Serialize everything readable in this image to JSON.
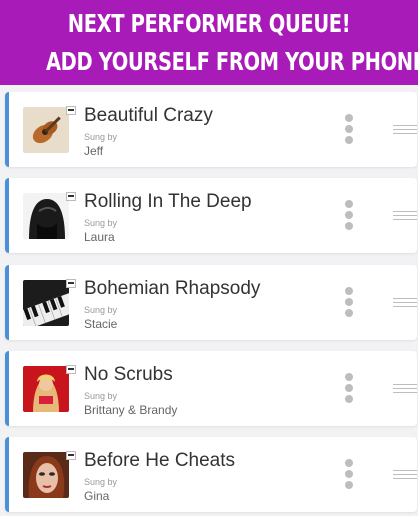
{
  "banner": {
    "line1": "NEXT PERFORMER QUEUE!",
    "line2": "ADD YOURSELF FROM YOUR PHONE"
  },
  "colors": {
    "banner_bg": "#a81bb8",
    "accent_bar": "#4a90d9"
  },
  "queue": [
    {
      "title": "Beautiful Crazy",
      "sung_by_label": "Sung by",
      "singer": "Jeff",
      "thumbnail": "guitar-image"
    },
    {
      "title": "Rolling In The Deep",
      "sung_by_label": "Sung by",
      "singer": "Laura",
      "thumbnail": "singer-portrait-bw"
    },
    {
      "title": "Bohemian Rhapsody",
      "sung_by_label": "Sung by",
      "singer": "Stacie",
      "thumbnail": "piano-keys"
    },
    {
      "title": "No Scrubs",
      "sung_by_label": "Sung by",
      "singer": "Brittany & Brandy",
      "thumbnail": "singer-portrait-red"
    },
    {
      "title": "Before He Cheats",
      "sung_by_label": "Sung by",
      "singer": "Gina",
      "thumbnail": "face-closeup"
    }
  ],
  "icons": {
    "more": "vertical-ellipsis-icon",
    "drag": "drag-handle-icon",
    "badge": "queue-badge-icon"
  }
}
